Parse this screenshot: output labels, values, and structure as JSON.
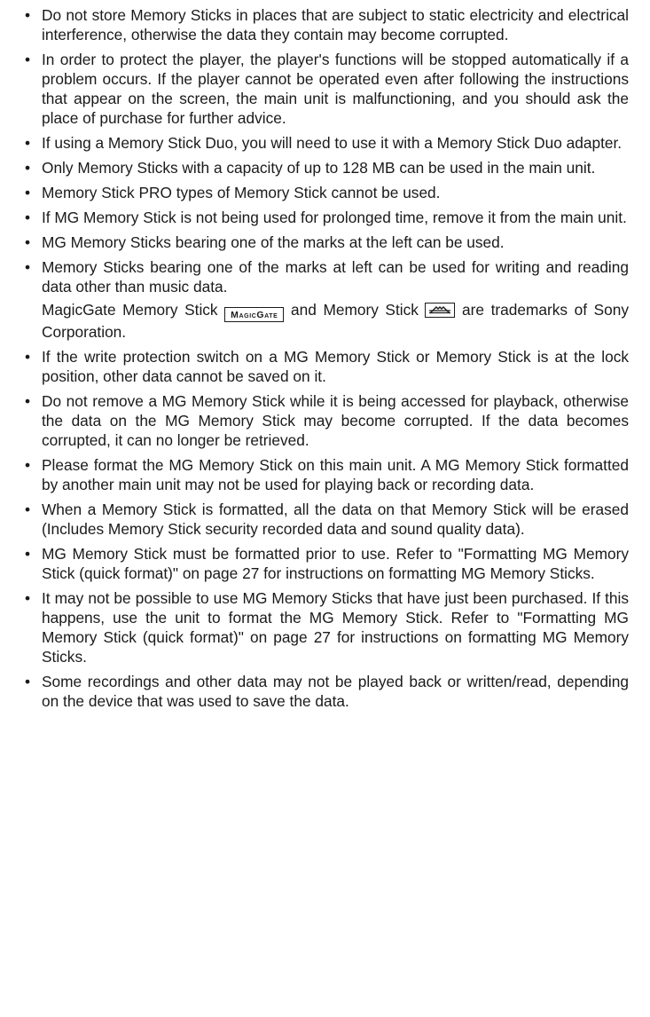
{
  "items": [
    "Do not store Memory Sticks in places that are subject to static electricity and electrical interference, otherwise the data they contain may become corrupted.",
    "In order to protect the player, the player's functions will be stopped automatically if a problem occurs. If the player cannot be operated even after following the instructions that appear on the screen, the main unit is malfunctioning, and you should ask the place of purchase for further advice.",
    "If using a Memory Stick Duo, you will need to use it with a Memory Stick Duo adapter.",
    "Only Memory Sticks with a capacity of up to 128 MB can be used in the main unit.",
    "Memory Stick PRO types of Memory Stick cannot be used.",
    "If MG Memory Stick is not being used for prolonged time, remove it from the main unit.",
    "MG Memory Sticks bearing one of the marks at the left can be used.",
    "Memory Sticks bearing one of the marks at left can be used for writing and reading data other than music data.",
    "If the write protection switch on a MG Memory Stick or Memory Stick is at the lock position, other data cannot be saved on it.",
    "Do not remove a MG Memory Stick while it is being accessed for playback, otherwise the data on the MG Memory Stick may become corrupted. If the data becomes corrupted, it can no longer be retrieved.",
    "Please format the MG Memory Stick on this main unit. A MG Memory Stick formatted by another main unit may not be used for playing back or recording data.",
    "When a Memory Stick is formatted, all the data on that Memory Stick will be erased (Includes Memory Stick security recorded data and sound quality data).",
    "MG Memory Stick must be formatted prior to use. Refer to \"Formatting MG Memory Stick (quick format)\" on page 27 for instructions on formatting MG Memory Sticks.",
    "It may not be possible to use MG Memory Sticks that have just been purchased. If this happens, use the unit to format the MG Memory Stick. Refer to \"Formatting MG Memory Stick (quick format)\" on page 27 for instructions on formatting MG Memory Sticks.",
    "Some recordings and other data may not be played back or written/read, depending on the device that was used to save the data."
  ],
  "trademark_note": {
    "part1": "MagicGate Memory Stick ",
    "magicgate_mark_text": "MagicGate",
    "part2": " and Memory Stick ",
    "memory_stick_mark_icon": "memory-stick-logo",
    "part3": " are trademarks of Sony Corporation."
  }
}
